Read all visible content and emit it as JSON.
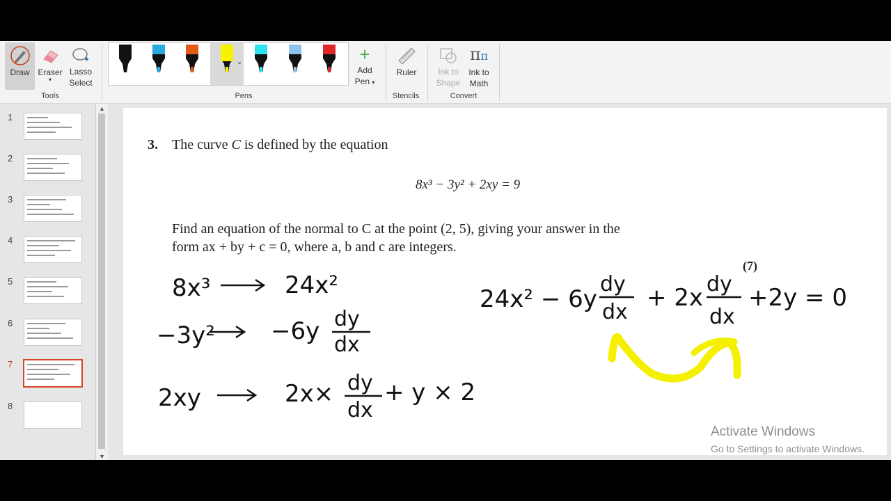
{
  "ribbon": {
    "tools": {
      "draw": "Draw",
      "eraser": "Eraser",
      "lasso_line1": "Lasso",
      "lasso_line2": "Select",
      "group": "Tools"
    },
    "pens": {
      "group": "Pens",
      "colors": [
        "#111111",
        "#2aa9e0",
        "#e25a13",
        "#f7f200",
        "#2ee3ef",
        "#8ec3ee",
        "#e0262b"
      ]
    },
    "add_pen": {
      "line1": "Add",
      "line2": "Pen"
    },
    "stencils": {
      "ruler": "Ruler",
      "group": "Stencils"
    },
    "convert": {
      "ink_shape_line1": "Ink to",
      "ink_shape_line2": "Shape",
      "ink_math_line1": "Ink to",
      "ink_math_line2": "Math",
      "group": "Convert"
    }
  },
  "thumbnails": [
    {
      "num": "1"
    },
    {
      "num": "2"
    },
    {
      "num": "3"
    },
    {
      "num": "4"
    },
    {
      "num": "5"
    },
    {
      "num": "6"
    },
    {
      "num": "7",
      "selected": true
    },
    {
      "num": "8"
    }
  ],
  "slide": {
    "question_number": "3.",
    "question_line1_pre": "The curve ",
    "question_C": "C",
    "question_line1_post": " is defined by the equation",
    "equation": "8x³ − 3y² + 2xy = 9",
    "find_line1": "Find an equation of the normal to C at the point (2, 5), giving your answer in the",
    "find_line2": "form ax + by + c = 0, where a, b and c are integers.",
    "marks": "(7)",
    "ink": {
      "l1_left": "8x³",
      "l1_right": "24x²",
      "l2_left": "−3y²",
      "l2_right": "−6y",
      "l2_frac_num": "dy",
      "l2_frac_den": "dx",
      "l3_left": "2xy",
      "l3_right_a": "2x×",
      "l3_frac_num": "dy",
      "l3_frac_den": "dx",
      "l3_right_b": "+ y × 2",
      "eq_a": "24x² − 6y",
      "eq_frac1_num": "dy",
      "eq_frac1_den": "dx",
      "eq_b": "+ 2x",
      "eq_frac2_num": "dy",
      "eq_frac2_den": "dx",
      "eq_c": "+2y = 0"
    }
  },
  "watermark": {
    "title": "Activate Windows",
    "subtitle": "Go to Settings to activate Windows."
  }
}
